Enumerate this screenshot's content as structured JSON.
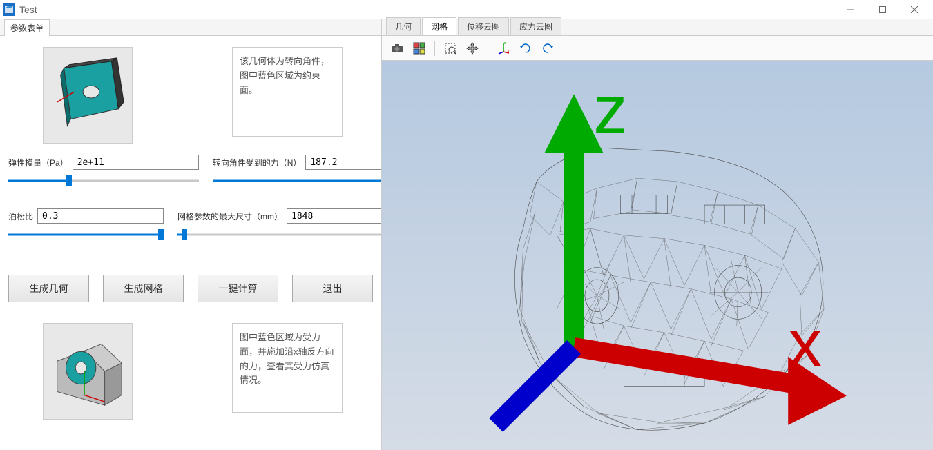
{
  "window": {
    "title": "Test"
  },
  "left_panel": {
    "header": "参数表单",
    "desc1": "该几何体为转向角件，图中蓝色区域为约束面。",
    "desc2": "图中蓝色区域为受力面，并施加沿x轴反方向的力，查看其受力仿真情况。",
    "params": {
      "elastic_modulus": {
        "label": "弹性模量（Pa）",
        "value": "2e+11",
        "slider_pct": 32
      },
      "force": {
        "label": "转向角件受到的力（N）",
        "value": "187.2",
        "slider_pct": 93
      },
      "poisson": {
        "label": "泊松比",
        "value": "0.3",
        "slider_pct": 98
      },
      "mesh_size": {
        "label": "网格参数的最大尺寸（mm）",
        "value": "1848",
        "slider_pct": 3
      }
    },
    "buttons": {
      "gen_geom": "生成几何",
      "gen_mesh": "生成网格",
      "one_click": "一键计算",
      "exit": "退出"
    }
  },
  "right_panel": {
    "tabs": {
      "geom": "几何",
      "mesh": "网格",
      "disp": "位移云图",
      "stress": "应力云图"
    },
    "active_tab": "mesh"
  }
}
